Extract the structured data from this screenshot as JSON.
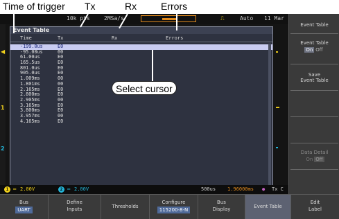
{
  "annotations": {
    "time_of_trigger": "Time of trigger",
    "tx": "Tx",
    "rx": "Rx",
    "errors": "Errors",
    "select_cursor": "Select cursor"
  },
  "status_top": {
    "record": "10k pts",
    "sample_rate": "2MSa/s",
    "trigger_mode": "Auto",
    "date": "11 Mar"
  },
  "event_table": {
    "title": "Event Table",
    "columns": [
      "Time",
      "Tx",
      "Rx",
      "Errors"
    ],
    "rows": [
      {
        "time": "-199.0us",
        "tx": "E0",
        "selected": true
      },
      {
        "time": "-95.00us",
        "tx": "00"
      },
      {
        "time": "61.00us",
        "tx": "E0"
      },
      {
        "time": "165.5us",
        "tx": "E0"
      },
      {
        "time": "801.0us",
        "tx": "E0"
      },
      {
        "time": "905.0us",
        "tx": "E0"
      },
      {
        "time": "1.009ms",
        "tx": "00"
      },
      {
        "time": "1.801ms",
        "tx": "00"
      },
      {
        "time": "2.165ms",
        "tx": "E0"
      },
      {
        "time": "2.800ms",
        "tx": "E0"
      },
      {
        "time": "2.905ms",
        "tx": "00"
      },
      {
        "time": "3.165ms",
        "tx": "E0"
      },
      {
        "time": "3.800ms",
        "tx": "E0"
      },
      {
        "time": "3.957ms",
        "tx": "00"
      },
      {
        "time": "4.165ms",
        "tx": "E0"
      }
    ]
  },
  "channel_markers": {
    "ch1": "1",
    "ch2": "2"
  },
  "status_bottom": {
    "ch1_num": "1",
    "ch1_scale": "2.00V",
    "ch2_num": "2",
    "ch2_scale": "2.00V",
    "timebase": "500us",
    "position": "1.96000ms",
    "trigger_label": "Tx C"
  },
  "side_menu": {
    "event_table_title": "Event Table",
    "event_table_label": "Event Table",
    "event_table_on": "On",
    "event_table_off": "Off",
    "save_line1": "Save",
    "save_line2": "Event Table",
    "data_detail": "Data Detail",
    "data_detail_on": "On",
    "data_detail_off": "Off"
  },
  "bottom_menu": {
    "bus_label": "Bus",
    "bus_value": "UART",
    "define_line1": "Define",
    "define_line2": "Inputs",
    "thresholds": "Thresholds",
    "configure_label": "Configure",
    "configure_value": "115200-8-N",
    "bus_display_line1": "Bus",
    "bus_display_line2": "Display",
    "event_table": "Event Table",
    "edit_line1": "Edit",
    "edit_line2": "Label"
  },
  "colors": {
    "ch1": "#f2d21c",
    "ch2": "#23b5d8",
    "selection": "#c9ccf2",
    "trigger_box": "#e08a1e",
    "panel": "#2e3240"
  }
}
